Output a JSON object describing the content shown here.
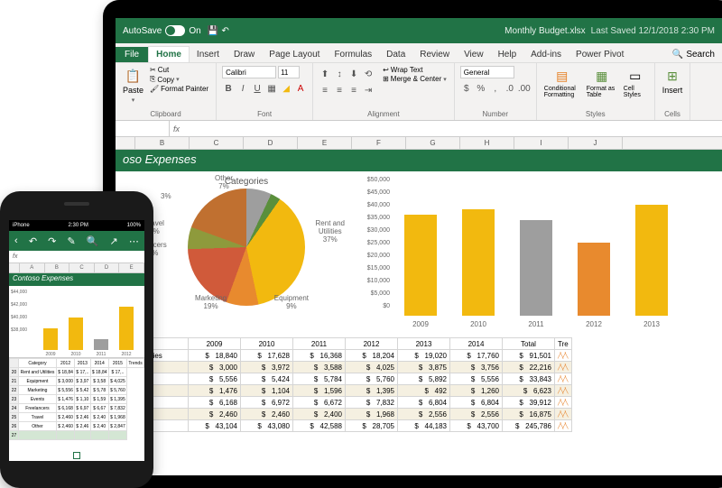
{
  "titlebar": {
    "autosave": "AutoSave",
    "on": "On",
    "filename": "Monthly Budget.xlsx",
    "saved": "Last Saved 12/1/2018 2:30 PM"
  },
  "tabs": {
    "file": "File",
    "home": "Home",
    "insert": "Insert",
    "draw": "Draw",
    "pagelayout": "Page Layout",
    "formulas": "Formulas",
    "data": "Data",
    "review": "Review",
    "view": "View",
    "help": "Help",
    "addins": "Add-ins",
    "powerpivot": "Power Pivot",
    "search": "Search"
  },
  "ribbon": {
    "clipboard": {
      "label": "Clipboard",
      "paste": "Paste",
      "cut": "Cut",
      "copy": "Copy",
      "fmtpainter": "Format Painter"
    },
    "font": {
      "label": "Font",
      "name": "Calibri",
      "size": "11"
    },
    "alignment": {
      "label": "Alignment",
      "wrap": "Wrap Text",
      "merge": "Merge & Center"
    },
    "number": {
      "label": "Number",
      "format": "General"
    },
    "styles": {
      "label": "Styles",
      "cond": "Conditional Formatting",
      "fmttable": "Format as Table",
      "cellstyles": "Cell Styles"
    },
    "cells": {
      "label": "Cells",
      "insert": "Insert"
    }
  },
  "sheet": {
    "banner": "oso Expenses"
  },
  "chart_data": [
    {
      "type": "pie",
      "title": "Categories",
      "slices": [
        {
          "label": "Other",
          "value": 7
        },
        {
          "label": "3%",
          "value": 3
        },
        {
          "label": "Rent and Utilities",
          "value": 37
        },
        {
          "label": "Equipment",
          "value": 9
        },
        {
          "label": "Marketing",
          "value": 19
        },
        {
          "label": "Travel",
          "value": 3
        },
        {
          "label": "eelancers",
          "value": 14
        }
      ]
    },
    {
      "type": "bar",
      "categories": [
        "2009",
        "2010",
        "2011",
        "2012",
        "2013"
      ],
      "values": [
        40000,
        42000,
        38000,
        29000,
        44000
      ],
      "colors": [
        "#f2b90f",
        "#f2b90f",
        "#9e9e9e",
        "#e88a2e",
        "#f2b90f"
      ],
      "yticks": [
        "$50,000",
        "$45,000",
        "$40,000",
        "$35,000",
        "$30,000",
        "$25,000",
        "$20,000",
        "$15,000",
        "$10,000",
        "$5,000",
        "$0"
      ],
      "ylim": [
        0,
        50000
      ]
    }
  ],
  "table": {
    "years": [
      "2009",
      "2010",
      "2011",
      "2012",
      "2013",
      "2014",
      "Total",
      "Tre"
    ],
    "rows": [
      {
        "label": "Utilities",
        "vals": [
          "18,840",
          "17,628",
          "16,368",
          "18,204",
          "19,020",
          "17,760",
          "91,501"
        ]
      },
      {
        "label": "t",
        "vals": [
          "3,000",
          "3,972",
          "3,588",
          "4,025",
          "3,875",
          "3,756",
          "22,216"
        ]
      },
      {
        "label": "",
        "vals": [
          "5,556",
          "5,424",
          "5,784",
          "5,760",
          "5,892",
          "5,556",
          "33,843"
        ]
      },
      {
        "label": "",
        "vals": [
          "1,476",
          "1,104",
          "1,596",
          "1,395",
          "492",
          "1,260",
          "6,623"
        ]
      },
      {
        "label": "",
        "vals": [
          "6,168",
          "6,972",
          "6,672",
          "7,832",
          "6,804",
          "6,804",
          "39,912"
        ]
      },
      {
        "label": "",
        "vals": [
          "2,460",
          "2,460",
          "2,400",
          "1,968",
          "2,556",
          "2,556",
          "16,875"
        ]
      },
      {
        "label": "",
        "vals": [
          "43,104",
          "43,080",
          "42,588",
          "28,705",
          "44,183",
          "43,700",
          "245,786"
        ]
      }
    ]
  },
  "phone": {
    "status": {
      "carrier": "iPhone",
      "time": "2:30 PM",
      "batt": "100%"
    },
    "fx": "fx",
    "cols": [
      "",
      "A",
      "B",
      "C",
      "D",
      "E"
    ],
    "banner": "Contoso Expenses",
    "bars": {
      "yticks": [
        "$44,000",
        "$42,000",
        "$40,000",
        "$38,000"
      ],
      "categories": [
        "2009",
        "2010",
        "2011",
        "2012"
      ],
      "values": [
        40000,
        42000,
        38000,
        44000
      ],
      "colors": [
        "#f2b90f",
        "#f2b90f",
        "#9e9e9e",
        "#f2b90f"
      ]
    },
    "table": {
      "headers": [
        "",
        "Category",
        "2012",
        "2013",
        "2014",
        "2015",
        "Trends"
      ],
      "rows": [
        [
          "20",
          "Rent and Utilities",
          "$ 18,84",
          "$ 17,..",
          "$ 18,84",
          "$ 17,.."
        ],
        [
          "21",
          "Equipment",
          "$ 3,000",
          "$ 3,97",
          "$ 3,58",
          "$ 4,025"
        ],
        [
          "22",
          "Marketing",
          "$ 5,556",
          "$ 5,42",
          "$ 5,78",
          "$ 5,760"
        ],
        [
          "23",
          "Events",
          "$ 1,476",
          "$ 1,10",
          "$ 1,59",
          "$ 1,395"
        ],
        [
          "24",
          "Freelancers",
          "$ 6,168",
          "$ 6,97",
          "$ 6,67",
          "$ 7,832"
        ],
        [
          "25",
          "Travel",
          "$ 2,460",
          "$ 2,46",
          "$ 2,40",
          "$ 1,968"
        ],
        [
          "26",
          "Other",
          "$ 2,460",
          "$ 2,46",
          "$ 2,40",
          "$ 2,847"
        ],
        [
          "27",
          "",
          "",
          "",
          "",
          ""
        ]
      ],
      "selrow": 7
    }
  }
}
